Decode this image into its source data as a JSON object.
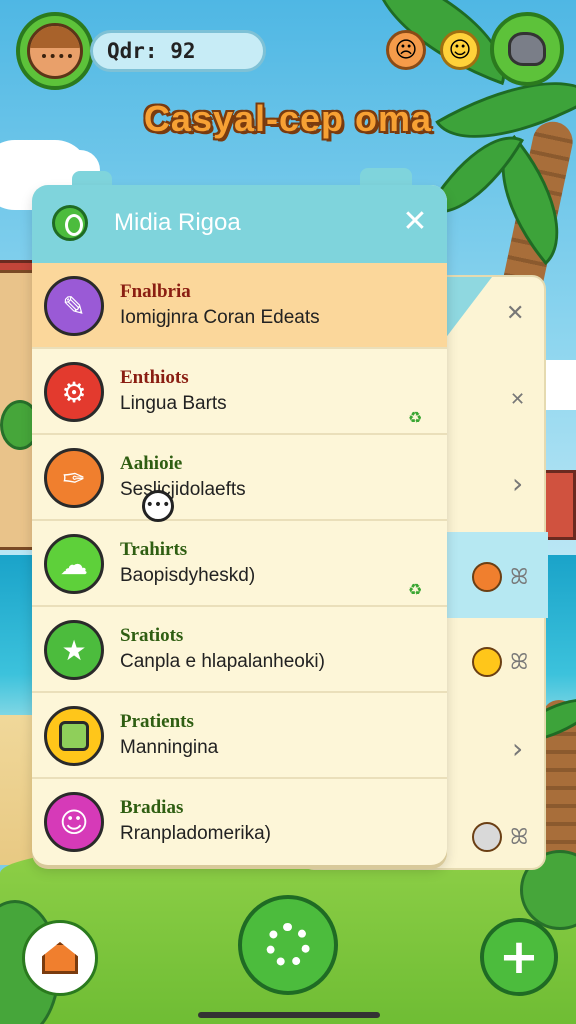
{
  "hud": {
    "player_name": "Qdr: 92",
    "game_title": "Casyal-cep oma"
  },
  "panel": {
    "title": "Midia Rigoa",
    "close_glyph": "✕"
  },
  "items": [
    {
      "title": "Fnalbria",
      "subtitle": "Iomigjnra Coran Edeats",
      "color": "#9a5ad6",
      "title_color": "#8a1e12",
      "icon": "tools-icon"
    },
    {
      "title": "Enthiots",
      "subtitle": "Lingua Barts",
      "color": "#e33a2e",
      "title_color": "#8a1e12",
      "icon": "gear-icon"
    },
    {
      "title": "Aahioie",
      "subtitle": "Seslicjidolaefts",
      "color": "#f07f2e",
      "title_color": "#2f5e12",
      "icon": "brush-icon"
    },
    {
      "title": "Trahirts",
      "subtitle": "Baopisdyheskd)",
      "color": "#5ed03a",
      "title_color": "#2f5e12",
      "icon": "chat-icon"
    },
    {
      "title": "Sratiots",
      "subtitle": "Canpla e hlapalanheoki)",
      "color": "#4cbc3d",
      "title_color": "#2f5e12",
      "icon": "star-icon"
    },
    {
      "title": "Pratients",
      "subtitle": "Manningina",
      "color": "#ffc61a",
      "title_color": "#2f5e12",
      "icon": "notebook-icon"
    },
    {
      "title": "Bradias",
      "subtitle": "Rranpladomerika)",
      "color": "#d63ab8",
      "title_color": "#2f5e12",
      "icon": "ghost-icon"
    }
  ],
  "back_panel": {
    "glyphs": [
      "✕",
      "✕",
      "›",
      "ꕤ",
      "ꕤ",
      "›",
      "ꕤ"
    ]
  },
  "colors": {
    "accent": "#4cbc3d",
    "panel_header": "#7fd4dc",
    "panel_bg": "#fdf6d8",
    "active_row": "#fbd79b"
  }
}
